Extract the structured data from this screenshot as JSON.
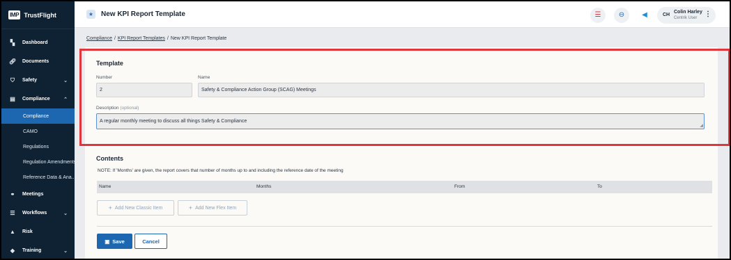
{
  "app": {
    "logo_box": "IMP",
    "logo_text": "TrustFlight"
  },
  "sidebar": {
    "items": [
      {
        "label": "Dashboard",
        "icon": "dashboard-icon"
      },
      {
        "label": "Documents",
        "icon": "paperclip-icon"
      },
      {
        "label": "Safety",
        "icon": "shield-icon",
        "chevron": "⌄"
      },
      {
        "label": "Compliance",
        "icon": "document-icon",
        "chevron": "⌃"
      },
      {
        "label": "Meetings",
        "icon": "meetings-icon"
      },
      {
        "label": "Workflows",
        "icon": "workflow-icon",
        "chevron": "⌄"
      },
      {
        "label": "Risk",
        "icon": "warning-icon"
      },
      {
        "label": "Training",
        "icon": "graduation-cap-icon",
        "chevron": "⌄"
      }
    ],
    "compliance_sub": [
      {
        "label": "Compliance",
        "active": true
      },
      {
        "label": "CAMO"
      },
      {
        "label": "Regulations"
      },
      {
        "label": "Regulation Amendments"
      },
      {
        "label": "Reference Data & Ana..."
      }
    ]
  },
  "header": {
    "title": "New KPI Report Template",
    "user": {
      "initials": "CH",
      "name": "Colin Harley",
      "role": "Centrik User"
    }
  },
  "breadcrumb": [
    "Compliance",
    "KPI Report Templates",
    "New KPI Report Template"
  ],
  "template": {
    "section_title": "Template",
    "number_label": "Number",
    "number_value": "2",
    "name_label": "Name",
    "name_value": "Safety & Compliance Action Group (SCAG) Meetings",
    "description_label": "Description",
    "description_optional": "(optional)",
    "description_value": "A regular monthly meeting to discuss all things Safety & Compliance"
  },
  "contents": {
    "section_title": "Contents",
    "note": "NOTE: If 'Months' are given, the report covers that number of months up to and including the reference date of the meeting",
    "columns": [
      "Name",
      "Months",
      "From",
      "To"
    ],
    "add_classic": "Add New Classic Item",
    "add_flex": "Add New Flex Item"
  },
  "actions": {
    "save": "Save",
    "cancel": "Cancel"
  },
  "colors": {
    "sidebar_bg": "#0f2233",
    "accent": "#1d67b0",
    "highlight": "#e0353d"
  }
}
